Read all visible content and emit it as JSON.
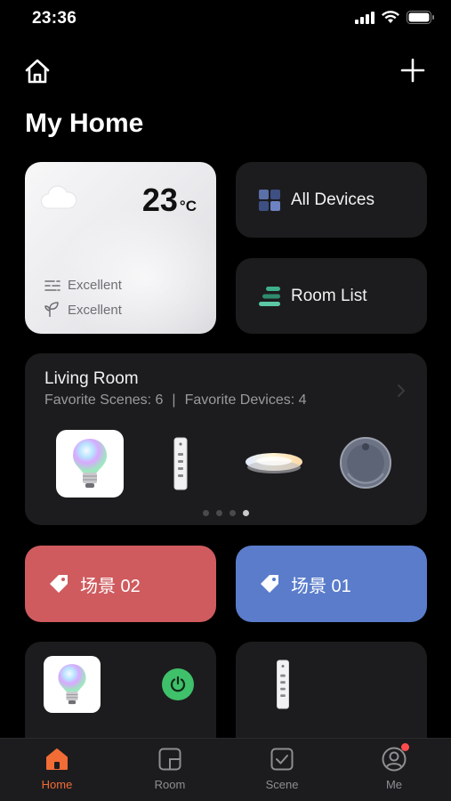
{
  "status_bar": {
    "time": "23:36"
  },
  "header": {
    "title": "My Home"
  },
  "weather": {
    "temperature": "23",
    "unit": "°C",
    "air_quality_1": "Excellent",
    "air_quality_2": "Excellent",
    "icon": "cloud-icon"
  },
  "tiles": {
    "all_devices": "All Devices",
    "room_list": "Room List"
  },
  "living_room": {
    "title": "Living Room",
    "favorite_scenes": "Favorite Scenes: 6",
    "separator": "|",
    "favorite_devices": "Favorite Devices: 4",
    "page_count": 4,
    "active_page": 4
  },
  "scenes": [
    {
      "label": "场景 02",
      "color": "#cf5b5f"
    },
    {
      "label": "场景 01",
      "color": "#5a7ccb"
    }
  ],
  "tab_bar": {
    "tabs": [
      {
        "label": "Home",
        "icon": "home-icon",
        "active": true
      },
      {
        "label": "Room",
        "icon": "room-icon",
        "active": false
      },
      {
        "label": "Scene",
        "icon": "scene-icon",
        "active": false
      },
      {
        "label": "Me",
        "icon": "profile-icon",
        "active": false,
        "badge": true
      }
    ]
  },
  "colors": {
    "accent": "#f26c36",
    "power_on": "#3fc06a",
    "scene_red": "#cf5b5f",
    "scene_blue": "#5a7ccb"
  }
}
